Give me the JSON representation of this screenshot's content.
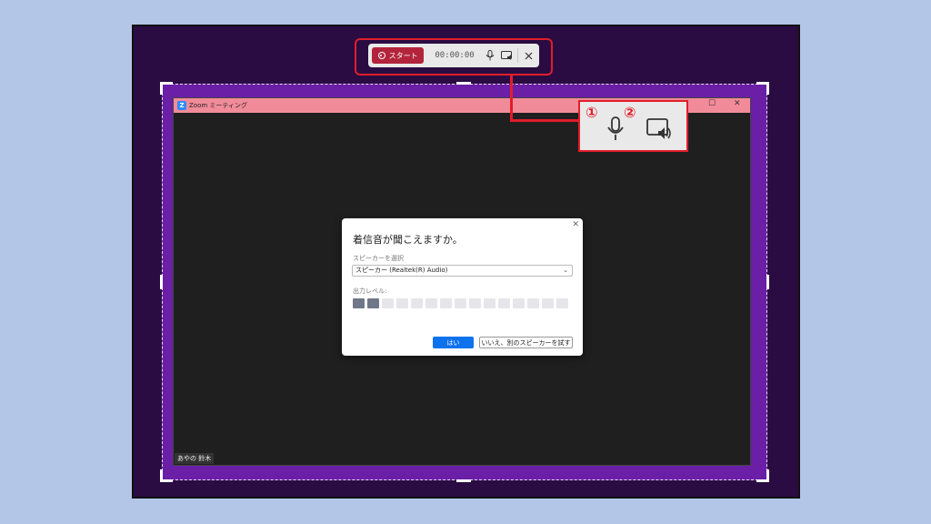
{
  "toolbar": {
    "start_label": "スタート",
    "timer": "00:00:00",
    "mic_icon": "microphone-icon",
    "system_audio_icon": "system-audio-icon",
    "close_icon": "close-icon"
  },
  "zoom_window": {
    "title": "Zoom ミーティング",
    "participant_name": "あやの 鈴木"
  },
  "callout": {
    "num1": "①",
    "num2": "②"
  },
  "dialog": {
    "title": "着信音が聞こえますか。",
    "speaker_label": "スピーカーを選択",
    "speaker_value": "スピーカー (Realtek(R) Audio)",
    "output_label": "出力レベル:",
    "output_level_active_segments": 2,
    "output_level_total_segments": 15,
    "yes_button": "はい",
    "other_button": "いいえ、別のスピーカーを試す"
  },
  "colors": {
    "highlight_red": "#e11d2a",
    "record_button": "#b2243b",
    "zoom_blue": "#0e72ed",
    "titlebar_pink": "#f28b99"
  }
}
